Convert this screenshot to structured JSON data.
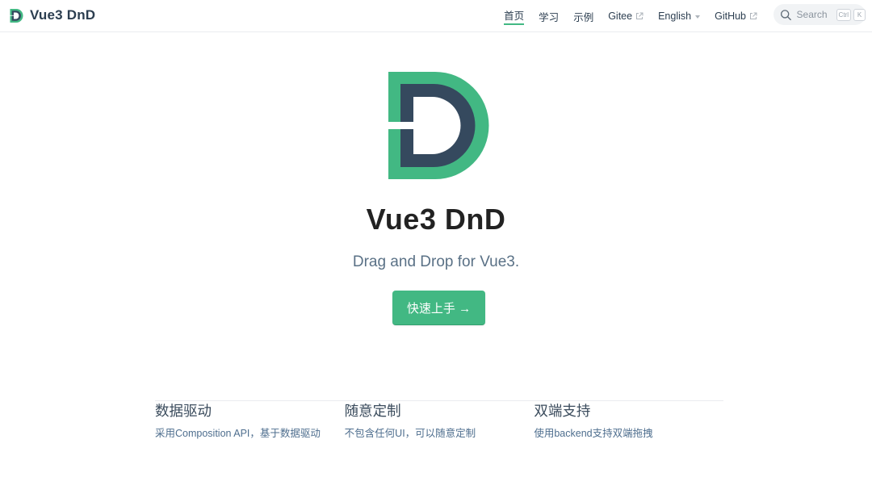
{
  "brand": {
    "title": "Vue3 DnD",
    "logo_icon": "vue3-dnd-logo-icon"
  },
  "nav": {
    "items": [
      {
        "label": "首页",
        "active": true,
        "external": false,
        "dropdown": false
      },
      {
        "label": "学习",
        "active": false,
        "external": false,
        "dropdown": false
      },
      {
        "label": "示例",
        "active": false,
        "external": false,
        "dropdown": false
      },
      {
        "label": "Gitee",
        "active": false,
        "external": true,
        "dropdown": false
      },
      {
        "label": "English",
        "active": false,
        "external": false,
        "dropdown": true
      },
      {
        "label": "GitHub",
        "active": false,
        "external": true,
        "dropdown": false
      }
    ]
  },
  "search": {
    "placeholder": "Search",
    "shortcut_keys": [
      "Ctrl",
      "K"
    ]
  },
  "hero": {
    "title": "Vue3 DnD",
    "description": "Drag and Drop for Vue3.",
    "action_label": "快速上手 →"
  },
  "features": [
    {
      "title": "数据驱动",
      "details": "采用Composition API，基于数据驱动"
    },
    {
      "title": "随意定制",
      "details": "不包含任何UI，可以随意定制"
    },
    {
      "title": "双端支持",
      "details": "使用backend支持双端拖拽"
    }
  ],
  "colors": {
    "accent": "#42b883",
    "dark": "#35495e",
    "text": "#2c3e50"
  }
}
